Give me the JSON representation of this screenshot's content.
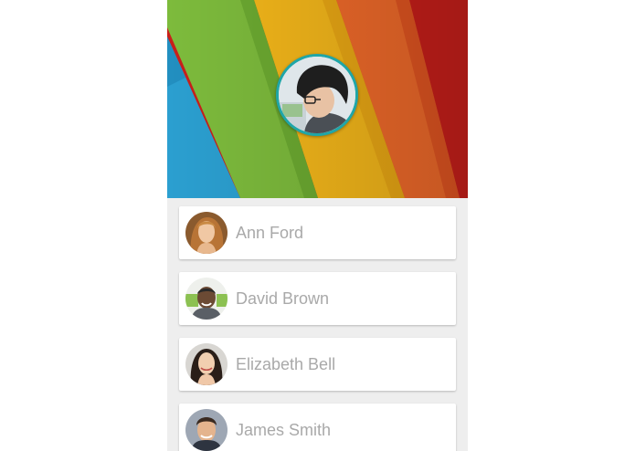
{
  "header": {
    "colors": {
      "blue": "#2b9fd0",
      "green": "#7dbb3c",
      "yellow": "#f4b71a",
      "orange": "#f06a2a",
      "red": "#c91f1a"
    },
    "profile_avatar_ring_color": "#1fa6a8"
  },
  "contacts": [
    {
      "name": "Ann Ford",
      "avatar": "woman-portrait"
    },
    {
      "name": "David Brown",
      "avatar": "man-portrait"
    },
    {
      "name": "Elizabeth Bell",
      "avatar": "woman-portrait"
    },
    {
      "name": "James Smith",
      "avatar": "man-portrait"
    }
  ]
}
